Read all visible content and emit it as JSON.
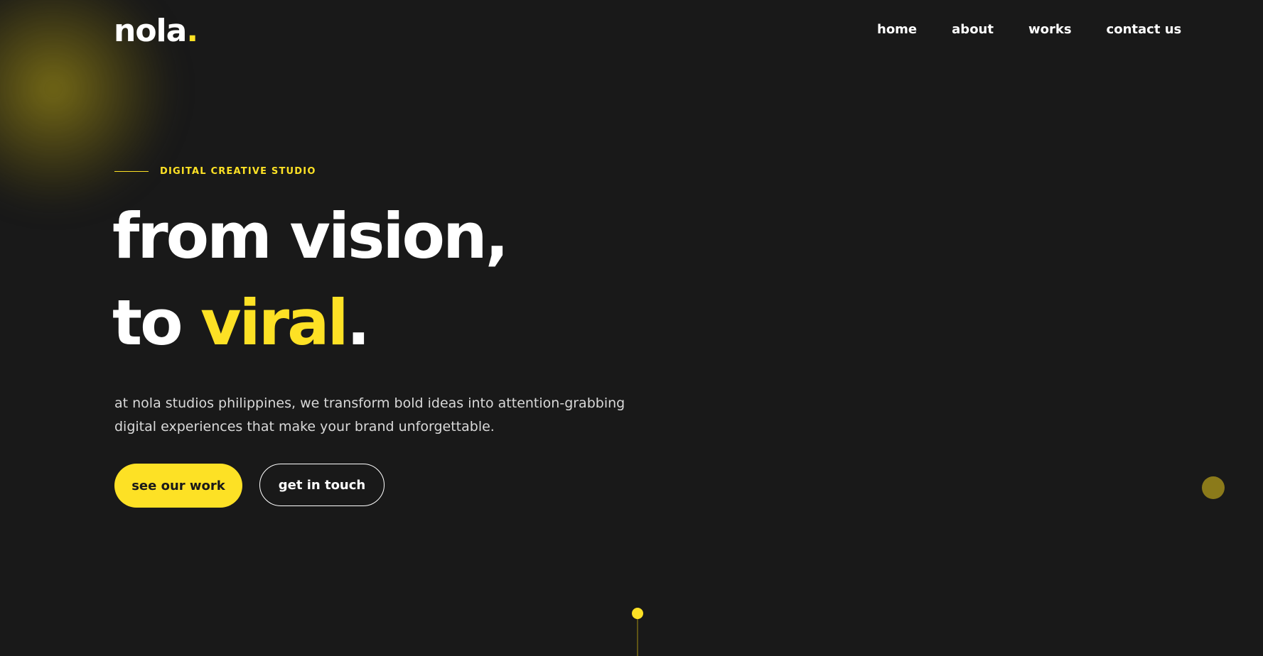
{
  "brand": {
    "logo_text": "nola",
    "logo_dot": "."
  },
  "nav": {
    "items": [
      {
        "label": "home"
      },
      {
        "label": "about"
      },
      {
        "label": "works"
      },
      {
        "label": "contact us"
      }
    ]
  },
  "hero": {
    "eyebrow": "DIGITAL CREATIVE STUDIO",
    "headline_line1": "from vision,",
    "headline_line2_prefix": "to ",
    "headline_line2_accent": "viral",
    "headline_line2_suffix": ".",
    "subtext": "at nola studios philippines, we transform bold ideas into attention-grabbing digital experiences that make your brand unforgettable.",
    "primary_button": "see our work",
    "secondary_button": "get in touch"
  },
  "colors": {
    "background": "#191919",
    "accent": "#fde125",
    "text": "#ffffff",
    "muted_text": "#d9d9d9"
  },
  "icons": {
    "floating_action": "circle-dot-icon",
    "scroll_indicator": "scroll-down-indicator-icon"
  }
}
